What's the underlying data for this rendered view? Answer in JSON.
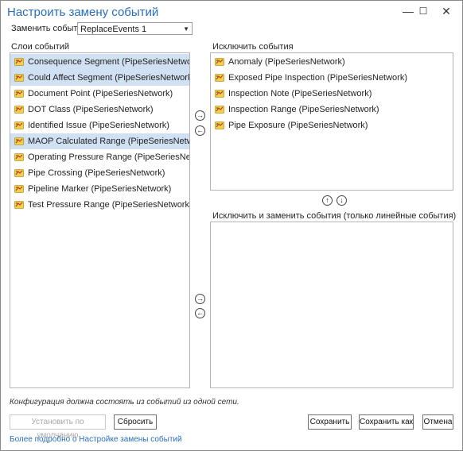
{
  "window": {
    "title": "Настроить замену событий",
    "min_glyph": "—",
    "max_glyph": "☐",
    "close_glyph": "✕"
  },
  "replace": {
    "label": "Заменить события",
    "selected": "ReplaceEvents 1",
    "caret": "▼"
  },
  "layers": {
    "label": "Слои событий",
    "items": [
      {
        "text": "Consequence Segment (PipeSeriesNetwork)",
        "selected": true
      },
      {
        "text": "Could Affect Segment (PipeSeriesNetwork)",
        "selected": true
      },
      {
        "text": "Document Point (PipeSeriesNetwork)",
        "selected": false
      },
      {
        "text": "DOT Class (PipeSeriesNetwork)",
        "selected": false
      },
      {
        "text": "Identified Issue (PipeSeriesNetwork)",
        "selected": false
      },
      {
        "text": "MAOP Calculated Range (PipeSeriesNetwork)",
        "selected": true
      },
      {
        "text": "Operating Pressure Range (PipeSeriesNetwork)",
        "selected": false
      },
      {
        "text": "Pipe Crossing (PipeSeriesNetwork)",
        "selected": false
      },
      {
        "text": "Pipeline Marker (PipeSeriesNetwork)",
        "selected": false
      },
      {
        "text": "Test Pressure Range (PipeSeriesNetwork)",
        "selected": false
      }
    ]
  },
  "exclude": {
    "label": "Исключить события",
    "items": [
      {
        "text": "Anomaly (PipeSeriesNetwork)"
      },
      {
        "text": "Exposed Pipe Inspection (PipeSeriesNetwork)"
      },
      {
        "text": "Inspection Note (PipeSeriesNetwork)"
      },
      {
        "text": "Inspection Range (PipeSeriesNetwork)"
      },
      {
        "text": "Pipe Exposure (PipeSeriesNetwork)"
      }
    ]
  },
  "exclude_replace": {
    "label": "Исключить и заменить события (только линейные события)",
    "items": []
  },
  "arrows": {
    "right": "→",
    "left": "←",
    "up": "↑",
    "down": "↓"
  },
  "note": "Конфигурация должна состоять из событий из одной сети.",
  "buttons": {
    "set_default": "Установить по умолчанию",
    "reset": "Сбросить",
    "save": "Сохранить",
    "save_as": "Сохранить как",
    "cancel": "Отмена"
  },
  "help_link": "Более подробно о Настройке замены событий",
  "colors": {
    "accent": "#2a6ebb",
    "selection": "#cfe1f3",
    "icon_fill": "#f2d04a",
    "icon_mark": "#c0392b"
  }
}
